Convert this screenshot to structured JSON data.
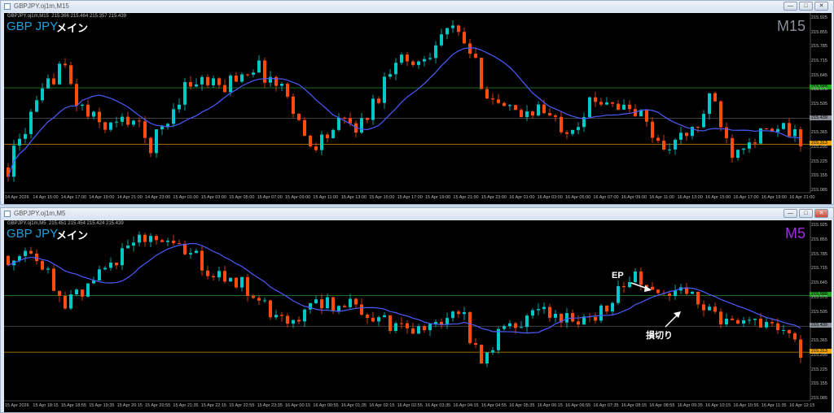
{
  "windows": [
    {
      "title": "GBPJPY.oj1m,M15",
      "info": "GBPJPY.oj1m,M15  215.366 215.464 215.357 215.439",
      "symbol": "GBP JPY",
      "label": "メイン",
      "timeframe": "M15",
      "tf_color": "#8a8f99",
      "buttons": {
        "min": "—",
        "max": "□",
        "close": "✕"
      },
      "price_labels": [
        "215.925",
        "215.855",
        "215.785",
        "215.715",
        "215.645",
        "215.575",
        "215.505",
        "215.365",
        "215.295",
        "215.225",
        "215.155",
        "215.085"
      ],
      "markers": [
        {
          "value": "215.588",
          "color": "#1fa81f",
          "line": "#1f7a1f"
        },
        {
          "value": "215.439",
          "color": "#8a8f99",
          "line": "#555"
        },
        {
          "value": "215.313",
          "color": "#f0a000",
          "line": "#b07a00"
        }
      ],
      "time_labels": [
        "14 Apr 2026",
        "14 Apr 15:00",
        "14 Apr 17:00",
        "14 Apr 19:00",
        "14 Apr 21:00",
        "14 Apr 23:00",
        "15 Apr 01:00",
        "15 Apr 03:00",
        "15 Apr 05:00",
        "15 Apr 07:00",
        "15 Apr 09:00",
        "15 Apr 11:00",
        "15 Apr 13:00",
        "15 Apr 15:00",
        "15 Apr 17:00",
        "15 Apr 19:00",
        "15 Apr 21:00",
        "15 Apr 23:00",
        "16 Apr 01:00",
        "16 Apr 03:00",
        "16 Apr 05:00",
        "16 Apr 07:00",
        "16 Apr 09:00",
        "16 Apr 11:00",
        "16 Apr 13:00",
        "16 Apr 15:00",
        "16 Apr 17:00",
        "16 Apr 19:00",
        "16 Apr 21:00"
      ]
    },
    {
      "title": "GBPJPY.oj1m,M5",
      "info": "GBPJPY.oj1m,M5  215.451 215.454 215.424 215.439",
      "symbol": "GBP JPY",
      "label": "メイン",
      "timeframe": "M5",
      "tf_color": "#9b30e0",
      "buttons": {
        "min": "—",
        "max": "□",
        "close": "✕"
      },
      "price_labels": [
        "215.925",
        "215.855",
        "215.785",
        "215.715",
        "215.645",
        "215.575",
        "215.505",
        "215.365",
        "215.295",
        "215.225",
        "215.155",
        "215.085"
      ],
      "markers": [
        {
          "value": "215.588",
          "color": "#1fa81f",
          "line": "#1f7a1f"
        },
        {
          "value": "215.439",
          "color": "#8a8f99",
          "line": "#555"
        },
        {
          "value": "215.313",
          "color": "#f0a000",
          "line": "#b07a00"
        }
      ],
      "time_labels": [
        "15 Apr 2026",
        "15 Apr 18:15",
        "15 Apr 18:55",
        "15 Apr 19:35",
        "15 Apr 20:15",
        "15 Apr 20:55",
        "15 Apr 21:35",
        "15 Apr 22:15",
        "15 Apr 22:55",
        "15 Apr 23:35",
        "16 Apr 00:15",
        "16 Apr 00:55",
        "16 Apr 01:35",
        "16 Apr 02:15",
        "16 Apr 02:55",
        "16 Apr 03:35",
        "16 Apr 04:15",
        "16 Apr 04:55",
        "16 Apr 05:35",
        "16 Apr 06:15",
        "16 Apr 06:55",
        "16 Apr 07:35",
        "16 Apr 08:15",
        "16 Apr 08:55",
        "16 Apr 09:35",
        "16 Apr 10:15",
        "16 Apr 10:55",
        "16 Apr 11:35",
        "16 Apr 12:15"
      ],
      "annotations": {
        "ep": "EP",
        "stop": "損切り"
      }
    }
  ],
  "chart_data": [
    {
      "type": "candlestick",
      "timeframe": "M15",
      "ylim": [
        215.085,
        215.925
      ],
      "up_color": "#00c8c8",
      "down_color": "#ff4a10",
      "ma_color": "#4a5cff",
      "approx_close_path": [
        215.2,
        215.4,
        215.55,
        215.72,
        215.5,
        215.42,
        215.4,
        215.45,
        215.3,
        215.42,
        215.6,
        215.62,
        215.58,
        215.65,
        215.7,
        215.62,
        215.55,
        215.3,
        215.35,
        215.42,
        215.4,
        215.55,
        215.75,
        215.7,
        215.78,
        215.88,
        215.8,
        215.6,
        215.48,
        215.45,
        215.5,
        215.42,
        215.4,
        215.5,
        215.55,
        215.48,
        215.45,
        215.3,
        215.33,
        215.38,
        215.55,
        215.28,
        215.35,
        215.36,
        215.38,
        215.34
      ]
    },
    {
      "type": "candlestick",
      "timeframe": "M5",
      "ylim": [
        215.085,
        215.925
      ],
      "up_color": "#00c8c8",
      "down_color": "#ff4a10",
      "ma_color": "#4a5cff",
      "approx_close_path": [
        215.78,
        215.76,
        215.7,
        215.56,
        215.62,
        215.68,
        215.8,
        215.87,
        215.84,
        215.8,
        215.76,
        215.7,
        215.68,
        215.58,
        215.5,
        215.44,
        215.52,
        215.54,
        215.54,
        215.5,
        215.46,
        215.44,
        215.42,
        215.46,
        215.52,
        215.25,
        215.4,
        215.44,
        215.5,
        215.52,
        215.42,
        215.5,
        215.56,
        215.68,
        215.62,
        215.56,
        215.6,
        215.5,
        215.44,
        215.5,
        215.46,
        215.4,
        215.3
      ]
    }
  ]
}
